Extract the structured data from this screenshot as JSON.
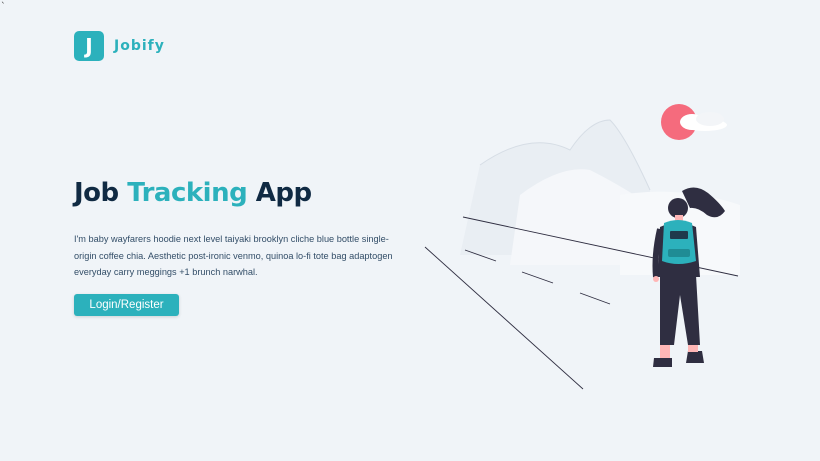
{
  "corner_mark": "`",
  "nav": {
    "logo_letter": "J",
    "logo_text": "Jobify"
  },
  "hero": {
    "title_part1": "Job",
    "title_accent": "Tracking",
    "title_part3": "App",
    "description": "I'm baby wayfarers hoodie next level taiyaki brooklyn cliche blue bottle single-origin coffee chia. Aesthetic post-ironic venmo, quinoa lo-fi tote bag adaptogen everyday carry meggings +1 brunch narwhal.",
    "cta_label": "Login/Register"
  },
  "colors": {
    "primary": "#2cb1bc",
    "heading": "#102a43",
    "background": "#f0f4f8",
    "sun": "#f56b7d"
  },
  "icons": [
    "logo-icon",
    "hero-illustration",
    "sun-icon",
    "cloud-icon",
    "person-icon",
    "backpack-icon"
  ]
}
